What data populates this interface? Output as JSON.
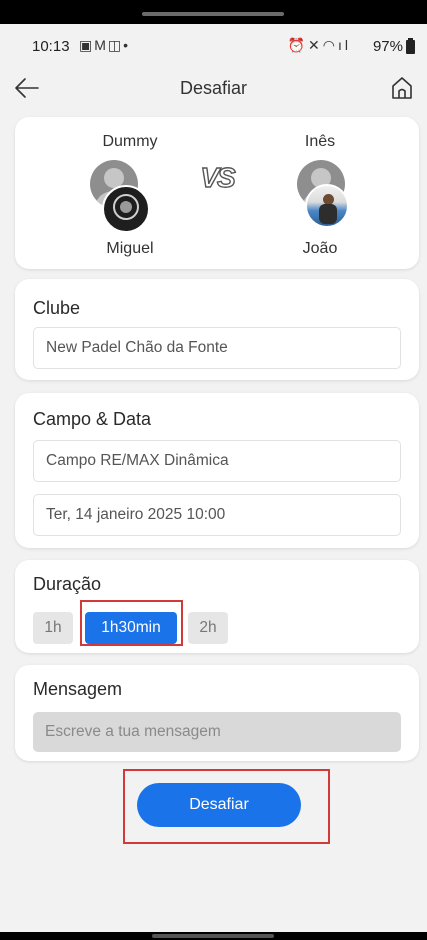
{
  "status_bar": {
    "time": "10:13",
    "left_icons": [
      "gallery-icon",
      "gmail-icon",
      "notification-icon",
      "dot-icon"
    ],
    "right_icons": [
      "alarm-icon",
      "mute-icon",
      "wifi-icon",
      "signal-icon"
    ],
    "battery": "97%"
  },
  "header": {
    "title": "Desafiar",
    "back_icon": "arrow-left-icon",
    "home_icon": "home-icon"
  },
  "match": {
    "vs_label": "VS",
    "team_left": {
      "top_player": "Dummy",
      "bottom_player": "Miguel"
    },
    "team_right": {
      "top_player": "Inês",
      "bottom_player": "João"
    }
  },
  "club": {
    "label": "Clube",
    "value": "New Padel Chão da Fonte"
  },
  "court_date": {
    "label": "Campo & Data",
    "court": "Campo RE/MAX Dinâmica",
    "datetime": "Ter, 14 janeiro 2025 10:00"
  },
  "duration": {
    "label": "Duração",
    "options": [
      "1h",
      "1h30min",
      "2h"
    ],
    "selected": "1h30min"
  },
  "message": {
    "label": "Mensagem",
    "placeholder": "Escreve a tua mensagem"
  },
  "submit_label": "Desafiar",
  "colors": {
    "accent": "#1a73e8",
    "background": "#f2f2f2",
    "highlight_box": "#d23a3a"
  }
}
